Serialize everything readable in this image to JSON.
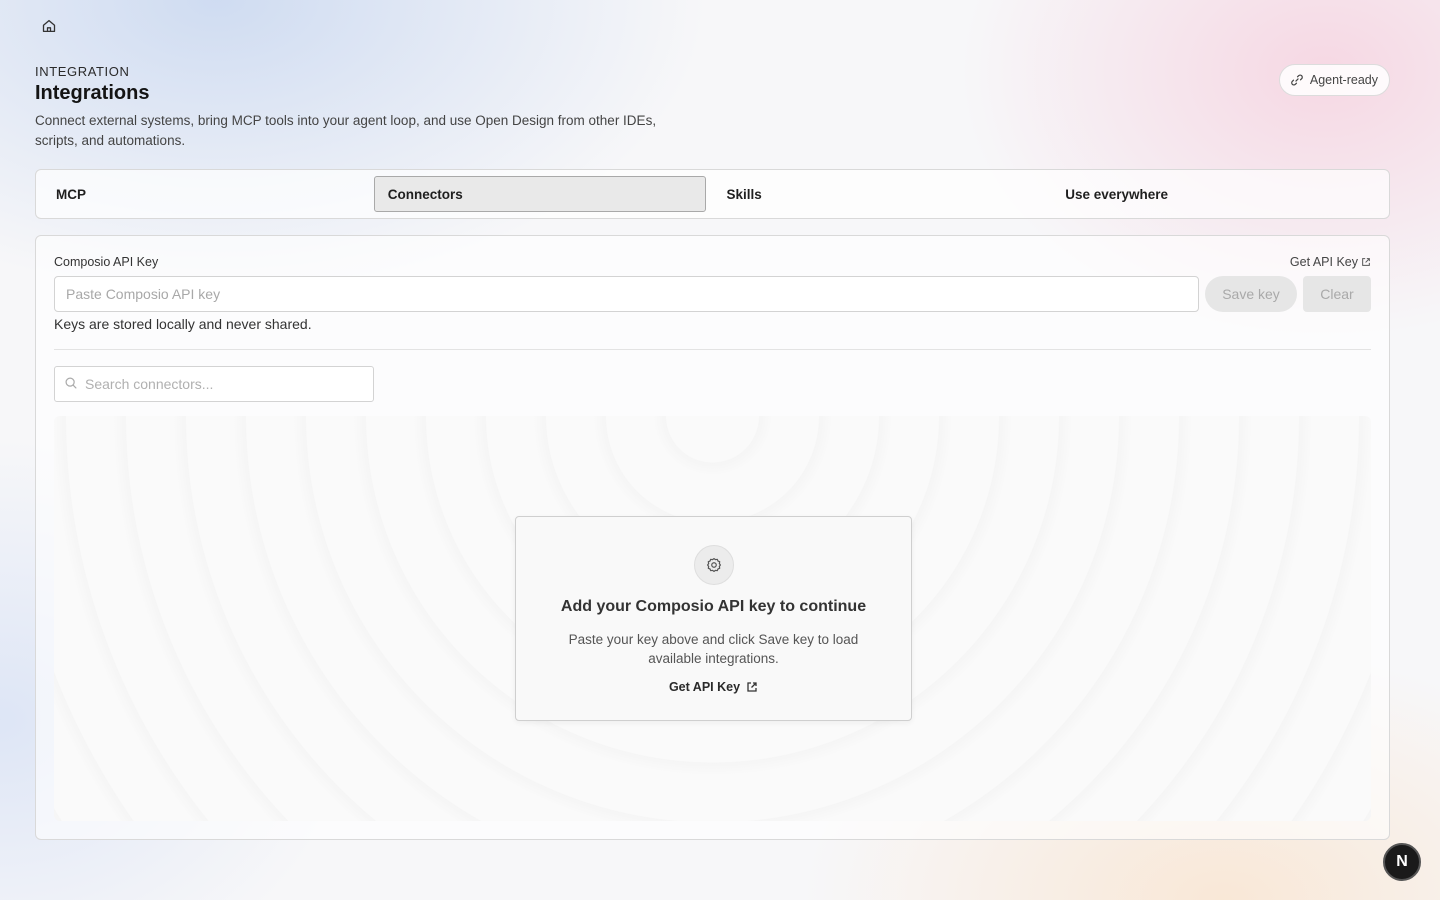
{
  "header": {
    "eyebrow": "INTEGRATION",
    "title": "Integrations",
    "subtitle": "Connect external systems, bring MCP tools into your agent loop, and use Open Design from other IDEs, scripts, and automations."
  },
  "agent_pill": {
    "label": "Agent-ready",
    "icon": "link-icon"
  },
  "tabs": [
    {
      "label": "MCP",
      "active": false
    },
    {
      "label": "Connectors",
      "active": true
    },
    {
      "label": "Skills",
      "active": false
    },
    {
      "label": "Use everywhere",
      "active": false
    }
  ],
  "api_key": {
    "label": "Composio API Key",
    "get_key_link": "Get API Key",
    "placeholder": "Paste Composio API key",
    "value": "",
    "save_label": "Save key",
    "clear_label": "Clear",
    "hint": "Keys are stored locally and never shared."
  },
  "search": {
    "placeholder": "Search connectors..."
  },
  "empty_state": {
    "icon": "gear-icon",
    "title": "Add your Composio API key to continue",
    "description": "Paste your key above and click Save key to load available integrations.",
    "link_label": "Get API Key"
  },
  "badge": {
    "label": "N"
  },
  "colors": {
    "active_tab_bg": "#e9e9e9",
    "badge_bg": "#1a1a1a"
  }
}
